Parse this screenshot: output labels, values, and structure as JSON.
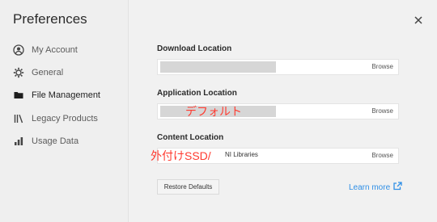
{
  "sidebar": {
    "title": "Preferences",
    "items": [
      {
        "label": "My Account",
        "icon": "account-icon"
      },
      {
        "label": "General",
        "icon": "gear-icon"
      },
      {
        "label": "File Management",
        "icon": "folder-icon",
        "active": true
      },
      {
        "label": "Legacy Products",
        "icon": "library-icon"
      },
      {
        "label": "Usage Data",
        "icon": "bar-chart-icon"
      }
    ]
  },
  "main": {
    "download": {
      "label": "Download Location",
      "browse": "Browse"
    },
    "application": {
      "label": "Application Location",
      "browse": "Browse",
      "annotation": "デフォルト"
    },
    "content": {
      "label": "Content Location",
      "value": "NI Libraries",
      "browse": "Browse",
      "annotation": "外付けSSD/"
    },
    "restore_label": "Restore Defaults",
    "learn_more": "Learn more"
  },
  "colors": {
    "accent": "#2f8fe6",
    "annotation": "#ff3b30"
  }
}
